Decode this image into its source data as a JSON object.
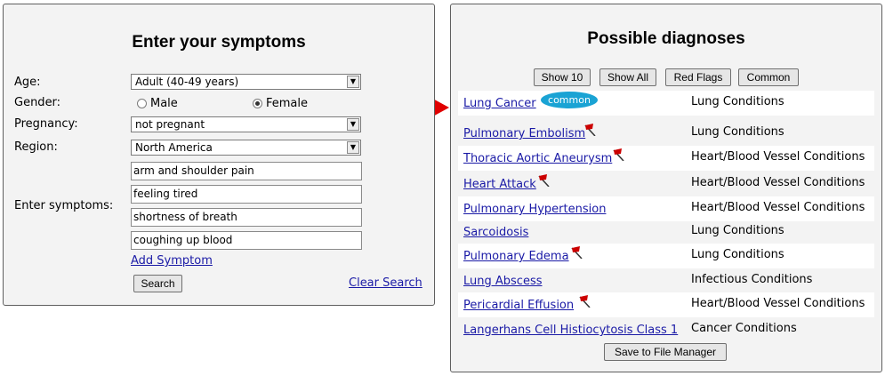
{
  "symptom_form": {
    "title": "Enter your symptoms",
    "age_label": "Age:",
    "age_value": "Adult (40-49 years)",
    "gender_label": "Gender:",
    "gender_male": "Male",
    "gender_female": "Female",
    "gender_selected": "Female",
    "pregnancy_label": "Pregnancy:",
    "pregnancy_value": "not pregnant",
    "region_label": "Region:",
    "region_value": "North America",
    "symptoms_label": "Enter symptoms:",
    "symptoms": [
      "arm and shoulder pain",
      "feeling tired",
      "shortness of breath",
      "coughing up blood"
    ],
    "add_symptom": "Add Symptom",
    "search_button": "Search",
    "clear_search": "Clear Search"
  },
  "diagnoses": {
    "title": "Possible diagnoses",
    "filters": [
      "Show 10",
      "Show All",
      "Red Flags",
      "Common"
    ],
    "common_badge": "common",
    "rows": [
      {
        "name": "Lung Cancer",
        "category": "Lung Conditions",
        "red_flag": false,
        "common": true
      },
      {
        "name": "Pulmonary Embolism",
        "category": "Lung Conditions",
        "red_flag": true,
        "common": false
      },
      {
        "name": "Thoracic Aortic Aneurysm",
        "category": "Heart/Blood Vessel Conditions",
        "red_flag": true,
        "common": false
      },
      {
        "name": "Heart Attack",
        "category": "Heart/Blood Vessel Conditions",
        "red_flag": true,
        "common": false
      },
      {
        "name": "Pulmonary Hypertension",
        "category": "Heart/Blood Vessel Conditions",
        "red_flag": false,
        "common": false
      },
      {
        "name": "Sarcoidosis",
        "category": "Lung Conditions",
        "red_flag": false,
        "common": false
      },
      {
        "name": "Pulmonary Edema",
        "category": "Lung Conditions",
        "red_flag": true,
        "common": false
      },
      {
        "name": "Lung Abscess",
        "category": "Infectious Conditions",
        "red_flag": false,
        "common": false
      },
      {
        "name": "Pericardial Effusion",
        "category": "Heart/Blood Vessel Conditions",
        "red_flag": true,
        "common": false
      },
      {
        "name": "Langerhans Cell Histiocytosis Class 1",
        "category": "Cancer Conditions",
        "red_flag": false,
        "common": false
      }
    ],
    "save_button": "Save to File Manager"
  },
  "colors": {
    "link": "#1a1aa6",
    "badge": "#1aa3d4",
    "arrow": "#e00000",
    "flag": "#cc0000"
  },
  "icons": [
    "chevron-down-icon",
    "red-flag-icon",
    "red-arrow-pointer"
  ]
}
